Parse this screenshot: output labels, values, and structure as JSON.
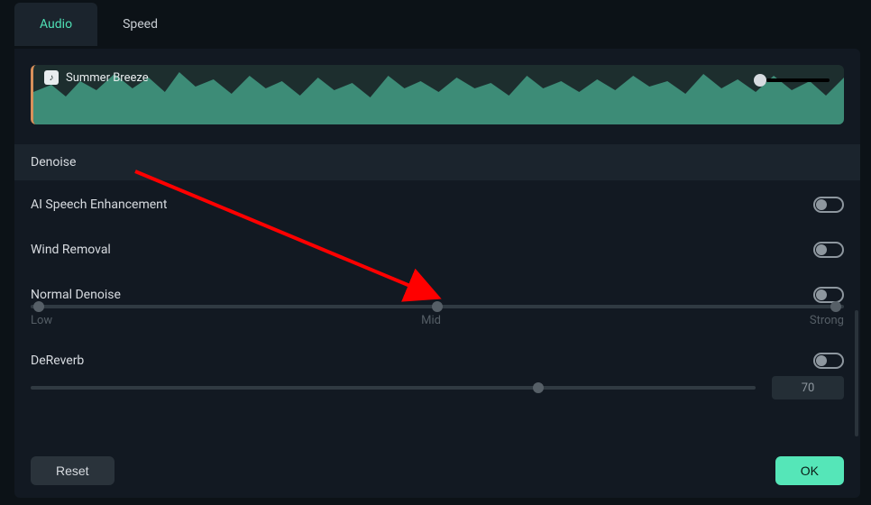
{
  "tabs": {
    "audio": "Audio",
    "speed": "Speed"
  },
  "track": {
    "title": "Summer Breeze"
  },
  "denoise": {
    "section_label": "Denoise",
    "ai_speech": "AI Speech Enhancement",
    "wind_removal": "Wind Removal",
    "normal_denoise": "Normal Denoise",
    "slider_low": "Low",
    "slider_mid": "Mid",
    "slider_strong": "Strong",
    "dereverb": "DeReverb",
    "dereverb_value": "70"
  },
  "footer": {
    "reset": "Reset",
    "ok": "OK"
  }
}
